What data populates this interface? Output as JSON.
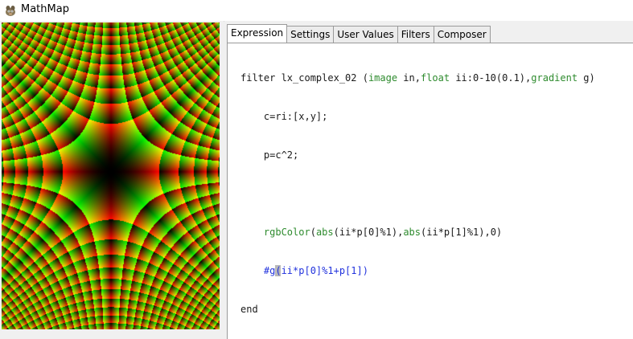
{
  "window": {
    "title": "MathMap",
    "app_icon": "gimp-icon"
  },
  "tabs": [
    {
      "label": "Expression",
      "active": true
    },
    {
      "label": "Settings",
      "active": false
    },
    {
      "label": "User Values",
      "active": false
    },
    {
      "label": "Filters",
      "active": false
    },
    {
      "label": "Composer",
      "active": false
    }
  ],
  "code": {
    "line1": {
      "prefix": "filter lx_complex_02 (",
      "t1": "image",
      "mid1": " in,",
      "t2": "float",
      "mid2": " ii:0-10(0.1),",
      "t3": "gradient",
      "suffix": " g)"
    },
    "line2": "    c=ri:[x,y];",
    "line3": "    p=c^2;",
    "line4": "",
    "line5": {
      "indent": "    ",
      "fn": "rgbColor",
      "a": "(",
      "abs1": "abs",
      "b": "(ii*p[0]%1),",
      "abs2": "abs",
      "c": "(ii*p[1]%1),0)"
    },
    "line6": {
      "indent": "    ",
      "head": "#g",
      "tail": "(ii*p[0]%1+p[1])"
    },
    "line7": "end"
  },
  "preview": {
    "description_icon": "fractal-preview",
    "colors": {
      "red": "#ff0000",
      "green": "#00ff00",
      "yellow": "#ffff00",
      "black": "#000000"
    }
  }
}
